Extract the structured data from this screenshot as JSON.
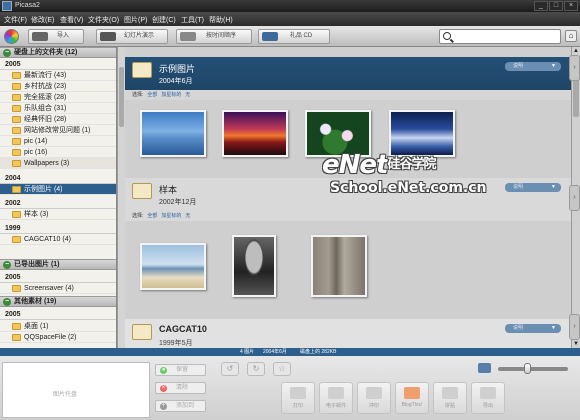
{
  "titlebar": {
    "title": "Picasa2"
  },
  "menu": [
    "文件(F)",
    "修改(E)",
    "查看(V)",
    "文件夹(O)",
    "图片(P)",
    "创建(C)",
    "工具(T)",
    "帮助(H)"
  ],
  "toolbar": {
    "import_label": "导入",
    "slideshow_label": "幻灯片演示",
    "timeline_label": "按时间顺序",
    "cd_label": "礼品 CD",
    "search_value": ""
  },
  "sidebar": {
    "group1": "硬盘上的文件夹 (12)",
    "year2005a": "2005",
    "items2005": [
      "最新流行 (43)",
      "乡村抗战 (23)",
      "完全摇滚 (28)",
      "乐队组合 (31)",
      "经典怀旧 (28)",
      "网站修改常见问题 (1)",
      "pic (14)",
      "pic (16)",
      "Wallpapers (3)"
    ],
    "year2004": "2004",
    "item2004": "示例图片 (4)",
    "year2002": "2002",
    "item2002": "样本 (3)",
    "year1999": "1999",
    "item1999": "CAGCAT10 (4)",
    "group2": "已导出图片 (1)",
    "year2005b": "2005",
    "item_screensaver": "Screensaver (4)",
    "group3": "其他素材 (19)",
    "year2005c": "2005",
    "items2005c": [
      "桌面 (1)",
      "QQSpaceFile (2)"
    ]
  },
  "sections": [
    {
      "name": "示例图片",
      "date": "2004年6月",
      "pill": "说明"
    },
    {
      "name": "样本",
      "date": "2002年12月",
      "pill": "说明"
    },
    {
      "name": "CAGCAT10",
      "date": "1999年5月",
      "pill": "说明"
    }
  ],
  "selection": {
    "label": "选择:",
    "all": "全部",
    "starred": "加星标的",
    "none": "无"
  },
  "watermark": {
    "main": "eNet",
    "cn": "硅谷学院",
    "sub": "School.eNet.com.cn"
  },
  "status": {
    "count": "4 图片",
    "date": "2004年6月",
    "size": "磁盘上的 282KB"
  },
  "bottom": {
    "tray_label": "图片托盘",
    "hold_label": "保留",
    "clear_label": "清除",
    "add_label": "添加到",
    "tools": [
      "打印",
      "电子邮件",
      "冲印",
      "BlogThis!",
      "拼贴",
      "导出"
    ]
  },
  "colors": {
    "accent": "#2d5f8c",
    "section_dark": "#245077",
    "folder": "#f2c65a"
  }
}
